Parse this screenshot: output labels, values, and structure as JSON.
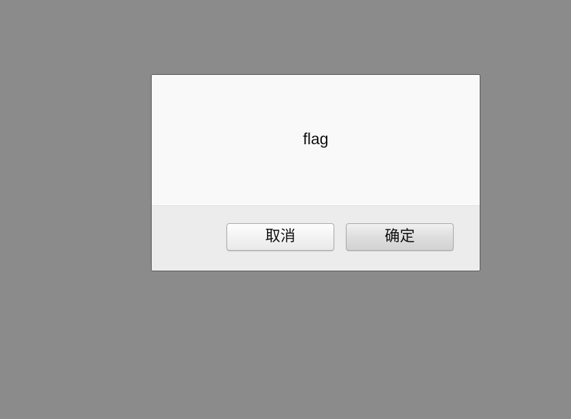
{
  "dialog": {
    "message": "flag",
    "cancel_label": "取消",
    "ok_label": "确定"
  },
  "colors": {
    "backdrop": "#8b8b8b",
    "dialog_body": "#f9f9f9",
    "dialog_footer": "#ececec"
  }
}
